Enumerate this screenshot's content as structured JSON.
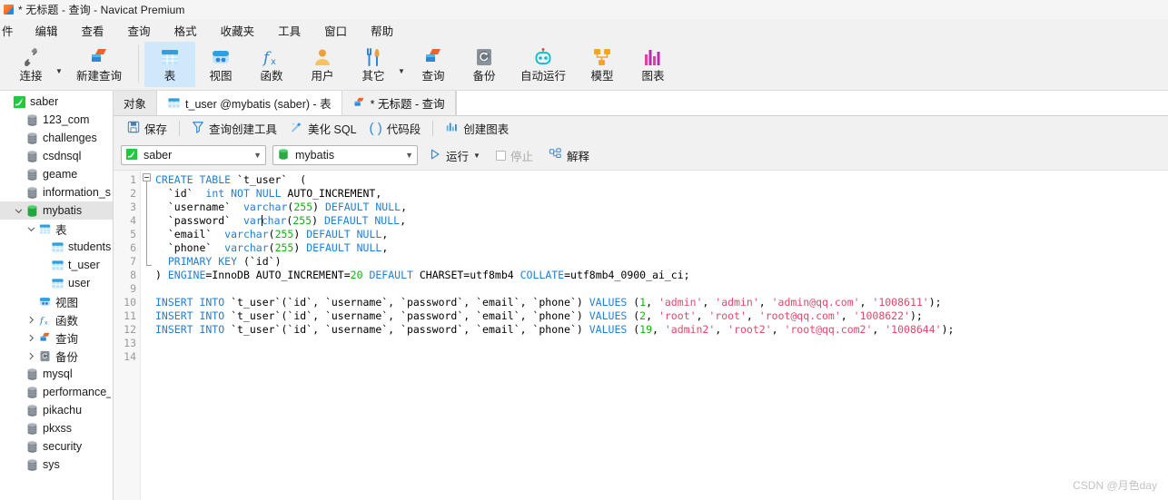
{
  "window": {
    "title": "* 无标题 - 查询 - Navicat Premium",
    "app_icon": "navicat-query-icon"
  },
  "menubar": {
    "items": [
      {
        "label": "件",
        "name": "menu-file"
      },
      {
        "label": "编辑",
        "name": "menu-edit"
      },
      {
        "label": "查看",
        "name": "menu-view"
      },
      {
        "label": "查询",
        "name": "menu-query"
      },
      {
        "label": "格式",
        "name": "menu-format"
      },
      {
        "label": "收藏夹",
        "name": "menu-favorites"
      },
      {
        "label": "工具",
        "name": "menu-tools"
      },
      {
        "label": "窗口",
        "name": "menu-window"
      },
      {
        "label": "帮助",
        "name": "menu-help"
      }
    ]
  },
  "ribbon": {
    "left": [
      {
        "label": "连接",
        "icon": "connection-icon",
        "name": "ribbon-connection",
        "caret": true
      },
      {
        "label": "新建查询",
        "icon": "new-query-icon",
        "name": "ribbon-new-query",
        "caret": false
      }
    ],
    "main": [
      {
        "label": "表",
        "icon": "table-icon",
        "name": "ribbon-table",
        "active": true,
        "caret": false
      },
      {
        "label": "视图",
        "icon": "view-icon",
        "name": "ribbon-view",
        "active": false,
        "caret": false
      },
      {
        "label": "函数",
        "icon": "function-icon",
        "name": "ribbon-function",
        "active": false,
        "caret": false
      },
      {
        "label": "用户",
        "icon": "user-icon",
        "name": "ribbon-user",
        "active": false,
        "caret": false
      },
      {
        "label": "其它",
        "icon": "other-icon",
        "name": "ribbon-other",
        "active": false,
        "caret": true
      },
      {
        "label": "查询",
        "icon": "query-icon",
        "name": "ribbon-query",
        "active": false,
        "caret": false
      },
      {
        "label": "备份",
        "icon": "backup-icon",
        "name": "ribbon-backup",
        "active": false,
        "caret": false
      },
      {
        "label": "自动运行",
        "icon": "automation-icon",
        "name": "ribbon-automation",
        "active": false,
        "caret": false
      },
      {
        "label": "模型",
        "icon": "model-icon",
        "name": "ribbon-model",
        "active": false,
        "caret": false
      },
      {
        "label": "图表",
        "icon": "chart-icon",
        "name": "ribbon-chart",
        "active": false,
        "caret": false
      }
    ]
  },
  "sidebar": {
    "items": [
      {
        "label": "saber",
        "icon": "connection-saber-icon",
        "indent": 0,
        "twisty": "none",
        "selected": false
      },
      {
        "label": "123_com",
        "icon": "database-icon",
        "indent": 1,
        "twisty": "none",
        "selected": false
      },
      {
        "label": "challenges",
        "icon": "database-icon",
        "indent": 1,
        "twisty": "none",
        "selected": false
      },
      {
        "label": "csdnsql",
        "icon": "database-icon",
        "indent": 1,
        "twisty": "none",
        "selected": false
      },
      {
        "label": "geame",
        "icon": "database-icon",
        "indent": 1,
        "twisty": "none",
        "selected": false
      },
      {
        "label": "information_schema",
        "icon": "database-icon",
        "indent": 1,
        "twisty": "none",
        "selected": false
      },
      {
        "label": "mybatis",
        "icon": "database-open-icon",
        "indent": 1,
        "twisty": "open",
        "selected": true
      },
      {
        "label": "表",
        "icon": "table-icon",
        "indent": 2,
        "twisty": "open",
        "selected": false
      },
      {
        "label": "students",
        "icon": "table-item-icon",
        "indent": 3,
        "twisty": "none",
        "selected": false
      },
      {
        "label": "t_user",
        "icon": "table-item-icon",
        "indent": 3,
        "twisty": "none",
        "selected": false
      },
      {
        "label": "user",
        "icon": "table-item-icon",
        "indent": 3,
        "twisty": "none",
        "selected": false
      },
      {
        "label": "视图",
        "icon": "view-icon",
        "indent": 2,
        "twisty": "none",
        "selected": false
      },
      {
        "label": "函数",
        "icon": "function-icon",
        "indent": 2,
        "twisty": "closed",
        "selected": false
      },
      {
        "label": "查询",
        "icon": "query-icon",
        "indent": 2,
        "twisty": "closed",
        "selected": false
      },
      {
        "label": "备份",
        "icon": "backup-icon",
        "indent": 2,
        "twisty": "closed",
        "selected": false
      },
      {
        "label": "mysql",
        "icon": "database-icon",
        "indent": 1,
        "twisty": "none",
        "selected": false
      },
      {
        "label": "performance_schema",
        "icon": "database-icon",
        "indent": 1,
        "twisty": "none",
        "selected": false
      },
      {
        "label": "pikachu",
        "icon": "database-icon",
        "indent": 1,
        "twisty": "none",
        "selected": false
      },
      {
        "label": "pkxss",
        "icon": "database-icon",
        "indent": 1,
        "twisty": "none",
        "selected": false
      },
      {
        "label": "security",
        "icon": "database-icon",
        "indent": 1,
        "twisty": "none",
        "selected": false
      },
      {
        "label": "sys",
        "icon": "database-icon",
        "indent": 1,
        "twisty": "none",
        "selected": false
      }
    ]
  },
  "tabs": [
    {
      "label": "对象",
      "icon": "none",
      "name": "tab-objects",
      "state": "gray"
    },
    {
      "label": "t_user @mybatis (saber) - 表",
      "icon": "table-item-icon",
      "name": "tab-t-user",
      "state": "white"
    },
    {
      "label": "* 无标题 - 查询",
      "icon": "query-icon",
      "name": "tab-untitled-query",
      "state": "active"
    }
  ],
  "query_toolbar": {
    "save": "保存",
    "query_builder": "查询创建工具",
    "beautify_sql": "美化 SQL",
    "code_snippet": "代码段",
    "create_chart": "创建图表"
  },
  "connbar": {
    "connection": {
      "value": "saber",
      "icon": "connection-saber-icon"
    },
    "database": {
      "value": "mybatis",
      "icon": "database-open-icon"
    },
    "run": "运行",
    "stop": "停止",
    "explain": "解释"
  },
  "editor": {
    "line_numbers": [
      "1",
      "2",
      "3",
      "4",
      "5",
      "6",
      "7",
      "8",
      "9",
      "10",
      "11",
      "12",
      "13",
      "14"
    ],
    "lines": [
      [
        {
          "t": "CREATE TABLE",
          "c": "kw"
        },
        {
          "t": " `t_user`  (",
          "c": "pl"
        }
      ],
      [
        {
          "t": "  `id`  ",
          "c": "pl"
        },
        {
          "t": "int",
          "c": "kw"
        },
        {
          "t": " ",
          "c": "pl"
        },
        {
          "t": "NOT NULL",
          "c": "kw"
        },
        {
          "t": " AUTO_INCREMENT,",
          "c": "pl"
        }
      ],
      [
        {
          "t": "  `username`  ",
          "c": "pl"
        },
        {
          "t": "varchar",
          "c": "kw"
        },
        {
          "t": "(",
          "c": "pl"
        },
        {
          "t": "255",
          "c": "num"
        },
        {
          "t": ") ",
          "c": "pl"
        },
        {
          "t": "DEFAULT NULL",
          "c": "kw"
        },
        {
          "t": ",",
          "c": "pl"
        }
      ],
      [
        {
          "t": "  `password`  ",
          "c": "pl"
        },
        {
          "t": "var",
          "c": "kw"
        },
        {
          "t": "|CARET|",
          "c": "caret"
        },
        {
          "t": "char",
          "c": "kw"
        },
        {
          "t": "(",
          "c": "pl"
        },
        {
          "t": "255",
          "c": "num"
        },
        {
          "t": ") ",
          "c": "pl"
        },
        {
          "t": "DEFAULT NULL",
          "c": "kw"
        },
        {
          "t": ",",
          "c": "pl"
        }
      ],
      [
        {
          "t": "  `email`  ",
          "c": "pl"
        },
        {
          "t": "varchar",
          "c": "kw"
        },
        {
          "t": "(",
          "c": "pl"
        },
        {
          "t": "255",
          "c": "num"
        },
        {
          "t": ") ",
          "c": "pl"
        },
        {
          "t": "DEFAULT NULL",
          "c": "kw"
        },
        {
          "t": ",",
          "c": "pl"
        }
      ],
      [
        {
          "t": "  `phone`  ",
          "c": "pl"
        },
        {
          "t": "varchar",
          "c": "kw"
        },
        {
          "t": "(",
          "c": "pl"
        },
        {
          "t": "255",
          "c": "num"
        },
        {
          "t": ") ",
          "c": "pl"
        },
        {
          "t": "DEFAULT NULL",
          "c": "kw"
        },
        {
          "t": ",",
          "c": "pl"
        }
      ],
      [
        {
          "t": "  ",
          "c": "pl"
        },
        {
          "t": "PRIMARY KEY",
          "c": "kw"
        },
        {
          "t": " (`id`)",
          "c": "pl"
        }
      ],
      [
        {
          "t": ") ",
          "c": "pl"
        },
        {
          "t": "ENGINE",
          "c": "kw"
        },
        {
          "t": "=InnoDB AUTO_INCREMENT=",
          "c": "pl"
        },
        {
          "t": "20",
          "c": "num"
        },
        {
          "t": " ",
          "c": "pl"
        },
        {
          "t": "DEFAULT",
          "c": "kw"
        },
        {
          "t": " CHARSET=utf8mb4 ",
          "c": "pl"
        },
        {
          "t": "COLLATE",
          "c": "kw"
        },
        {
          "t": "=utf8mb4_0900_ai_ci;",
          "c": "pl"
        }
      ],
      [],
      [
        {
          "t": "INSERT INTO",
          "c": "kw"
        },
        {
          "t": " `t_user`(`id`, `username`, `password`, `email`, `phone`) ",
          "c": "pl"
        },
        {
          "t": "VALUES",
          "c": "kw"
        },
        {
          "t": " (",
          "c": "pl"
        },
        {
          "t": "1",
          "c": "num"
        },
        {
          "t": ", ",
          "c": "pl"
        },
        {
          "t": "'admin'",
          "c": "str"
        },
        {
          "t": ", ",
          "c": "pl"
        },
        {
          "t": "'admin'",
          "c": "str"
        },
        {
          "t": ", ",
          "c": "pl"
        },
        {
          "t": "'admin@qq.com'",
          "c": "str"
        },
        {
          "t": ", ",
          "c": "pl"
        },
        {
          "t": "'1008611'",
          "c": "str"
        },
        {
          "t": ");",
          "c": "pl"
        }
      ],
      [
        {
          "t": "INSERT INTO",
          "c": "kw"
        },
        {
          "t": " `t_user`(`id`, `username`, `password`, `email`, `phone`) ",
          "c": "pl"
        },
        {
          "t": "VALUES",
          "c": "kw"
        },
        {
          "t": " (",
          "c": "pl"
        },
        {
          "t": "2",
          "c": "num"
        },
        {
          "t": ", ",
          "c": "pl"
        },
        {
          "t": "'root'",
          "c": "str"
        },
        {
          "t": ", ",
          "c": "pl"
        },
        {
          "t": "'root'",
          "c": "str"
        },
        {
          "t": ", ",
          "c": "pl"
        },
        {
          "t": "'root@qq.com'",
          "c": "str"
        },
        {
          "t": ", ",
          "c": "pl"
        },
        {
          "t": "'1008622'",
          "c": "str"
        },
        {
          "t": ");",
          "c": "pl"
        }
      ],
      [
        {
          "t": "INSERT INTO",
          "c": "kw"
        },
        {
          "t": " `t_user`(`id`, `username`, `password`, `email`, `phone`) ",
          "c": "pl"
        },
        {
          "t": "VALUES",
          "c": "kw"
        },
        {
          "t": " (",
          "c": "pl"
        },
        {
          "t": "19",
          "c": "num"
        },
        {
          "t": ", ",
          "c": "pl"
        },
        {
          "t": "'admin2'",
          "c": "str"
        },
        {
          "t": ", ",
          "c": "pl"
        },
        {
          "t": "'root2'",
          "c": "str"
        },
        {
          "t": ", ",
          "c": "pl"
        },
        {
          "t": "'root@qq.com2'",
          "c": "str"
        },
        {
          "t": ", ",
          "c": "pl"
        },
        {
          "t": "'1008644'",
          "c": "str"
        },
        {
          "t": ");",
          "c": "pl"
        }
      ],
      [],
      [
        {
          "t": "|CARET|",
          "c": "caret"
        }
      ]
    ]
  },
  "watermark": "CSDN @月色day",
  "colors": {
    "keyword": "#1f7fd4",
    "number": "#12b212",
    "string": "#e6456b",
    "accent": "#2f86d8",
    "selection": "#cfe8fb"
  }
}
